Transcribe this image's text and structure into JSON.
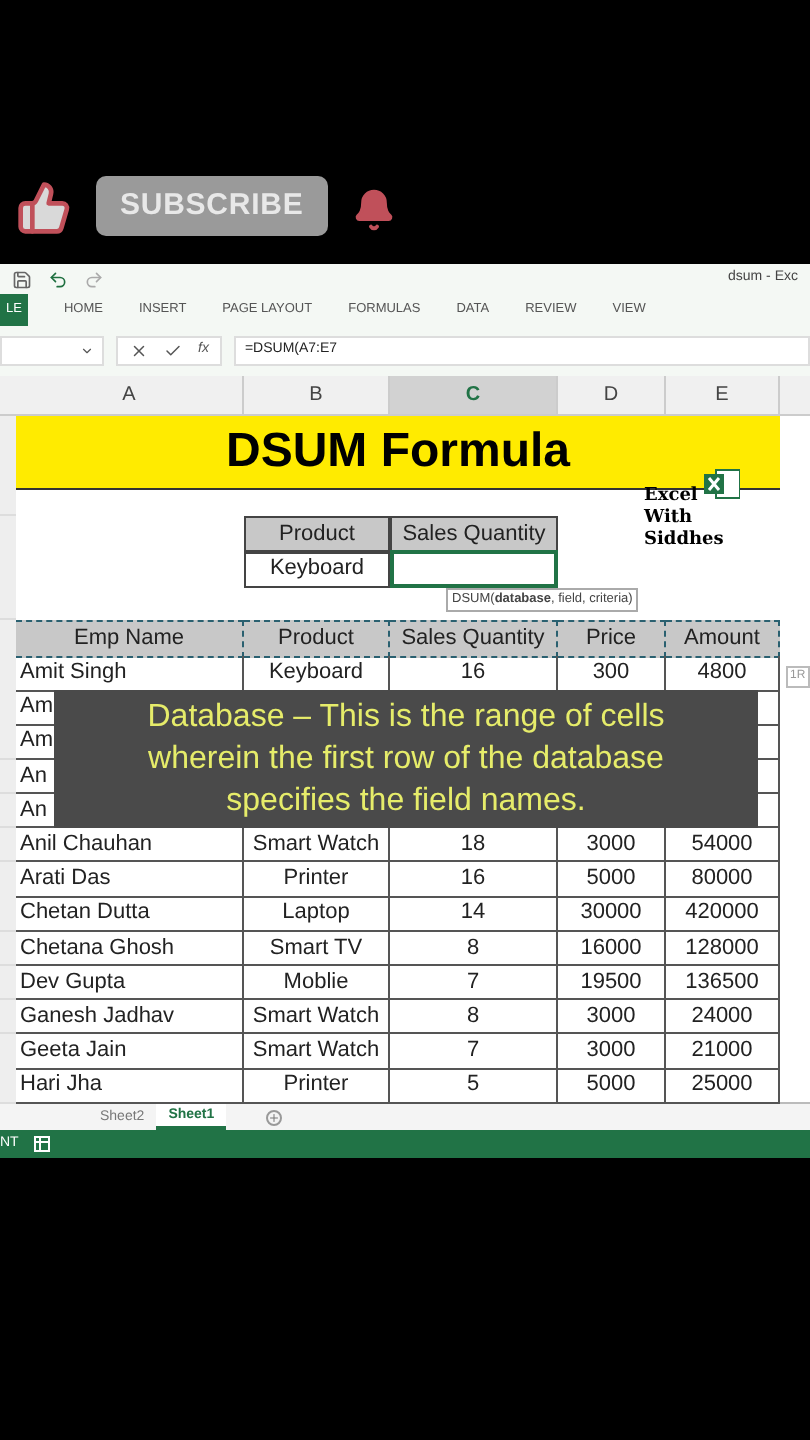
{
  "promo": {
    "subscribe": "SUBSCRIBE"
  },
  "window": {
    "title": "dsum - Exc"
  },
  "ribbon_tabs": [
    {
      "label": "LE",
      "selected": true
    },
    {
      "label": "HOME",
      "selected": false
    },
    {
      "label": "INSERT",
      "selected": false
    },
    {
      "label": "PAGE LAYOUT",
      "selected": false
    },
    {
      "label": "FORMULAS",
      "selected": false
    },
    {
      "label": "DATA",
      "selected": false
    },
    {
      "label": "REVIEW",
      "selected": false
    },
    {
      "label": "VIEW",
      "selected": false
    }
  ],
  "formula_bar": {
    "fx": "fx",
    "formula": "=DSUM(A7:E7"
  },
  "column_headers": [
    {
      "label": "A",
      "selected": false
    },
    {
      "label": "B",
      "selected": false
    },
    {
      "label": "C",
      "selected": true
    },
    {
      "label": "D",
      "selected": false
    },
    {
      "label": "E",
      "selected": false
    }
  ],
  "sheet": {
    "title": "DSUM Formula",
    "logo": [
      "Excel",
      "With",
      "Siddhes"
    ],
    "criteria": {
      "headers": [
        "Product",
        "Sales Quantity"
      ],
      "values": [
        "Keyboard"
      ]
    },
    "tooltip": "DSUM(**database**, field, criteria)",
    "side_tag": "1R",
    "table": {
      "columns": [
        "Emp Name",
        "Product",
        "Sales Quantity",
        "Price",
        "Amount"
      ],
      "rows": [
        [
          "Amit Singh",
          "Keyboard",
          "16",
          "300",
          "4800"
        ],
        [
          "Am",
          null,
          null,
          null,
          null
        ],
        [
          "Am",
          null,
          null,
          null,
          null
        ],
        [
          "An",
          null,
          null,
          null,
          null
        ],
        [
          "An",
          null,
          null,
          null,
          null
        ],
        [
          "Anil Chauhan",
          "Smart Watch",
          "18",
          "3000",
          "54000"
        ],
        [
          "Arati Das",
          "Printer",
          "16",
          "5000",
          "80000"
        ],
        [
          "Chetan Dutta",
          "Laptop",
          "14",
          "30000",
          "420000"
        ],
        [
          "Chetana Ghosh",
          "Smart TV",
          "8",
          "16000",
          "128000"
        ],
        [
          "Dev Gupta",
          "Moblie",
          "7",
          "19500",
          "136500"
        ],
        [
          "Ganesh Jadhav",
          "Smart Watch",
          "8",
          "3000",
          "24000"
        ],
        [
          "Geeta Jain",
          "Smart Watch",
          "7",
          "3000",
          "21000"
        ],
        [
          "Hari Jha",
          "Printer",
          "5",
          "5000",
          "25000"
        ]
      ]
    }
  },
  "caption": [
    "Database – This is the range of cells",
    "wherein the first row of the database",
    "specifies the field names."
  ],
  "sheet_tabs": [
    {
      "label": "Sheet2",
      "selected": false
    },
    {
      "label": "Sheet1",
      "selected": true
    }
  ],
  "status_bar": {
    "mode": "NT"
  }
}
